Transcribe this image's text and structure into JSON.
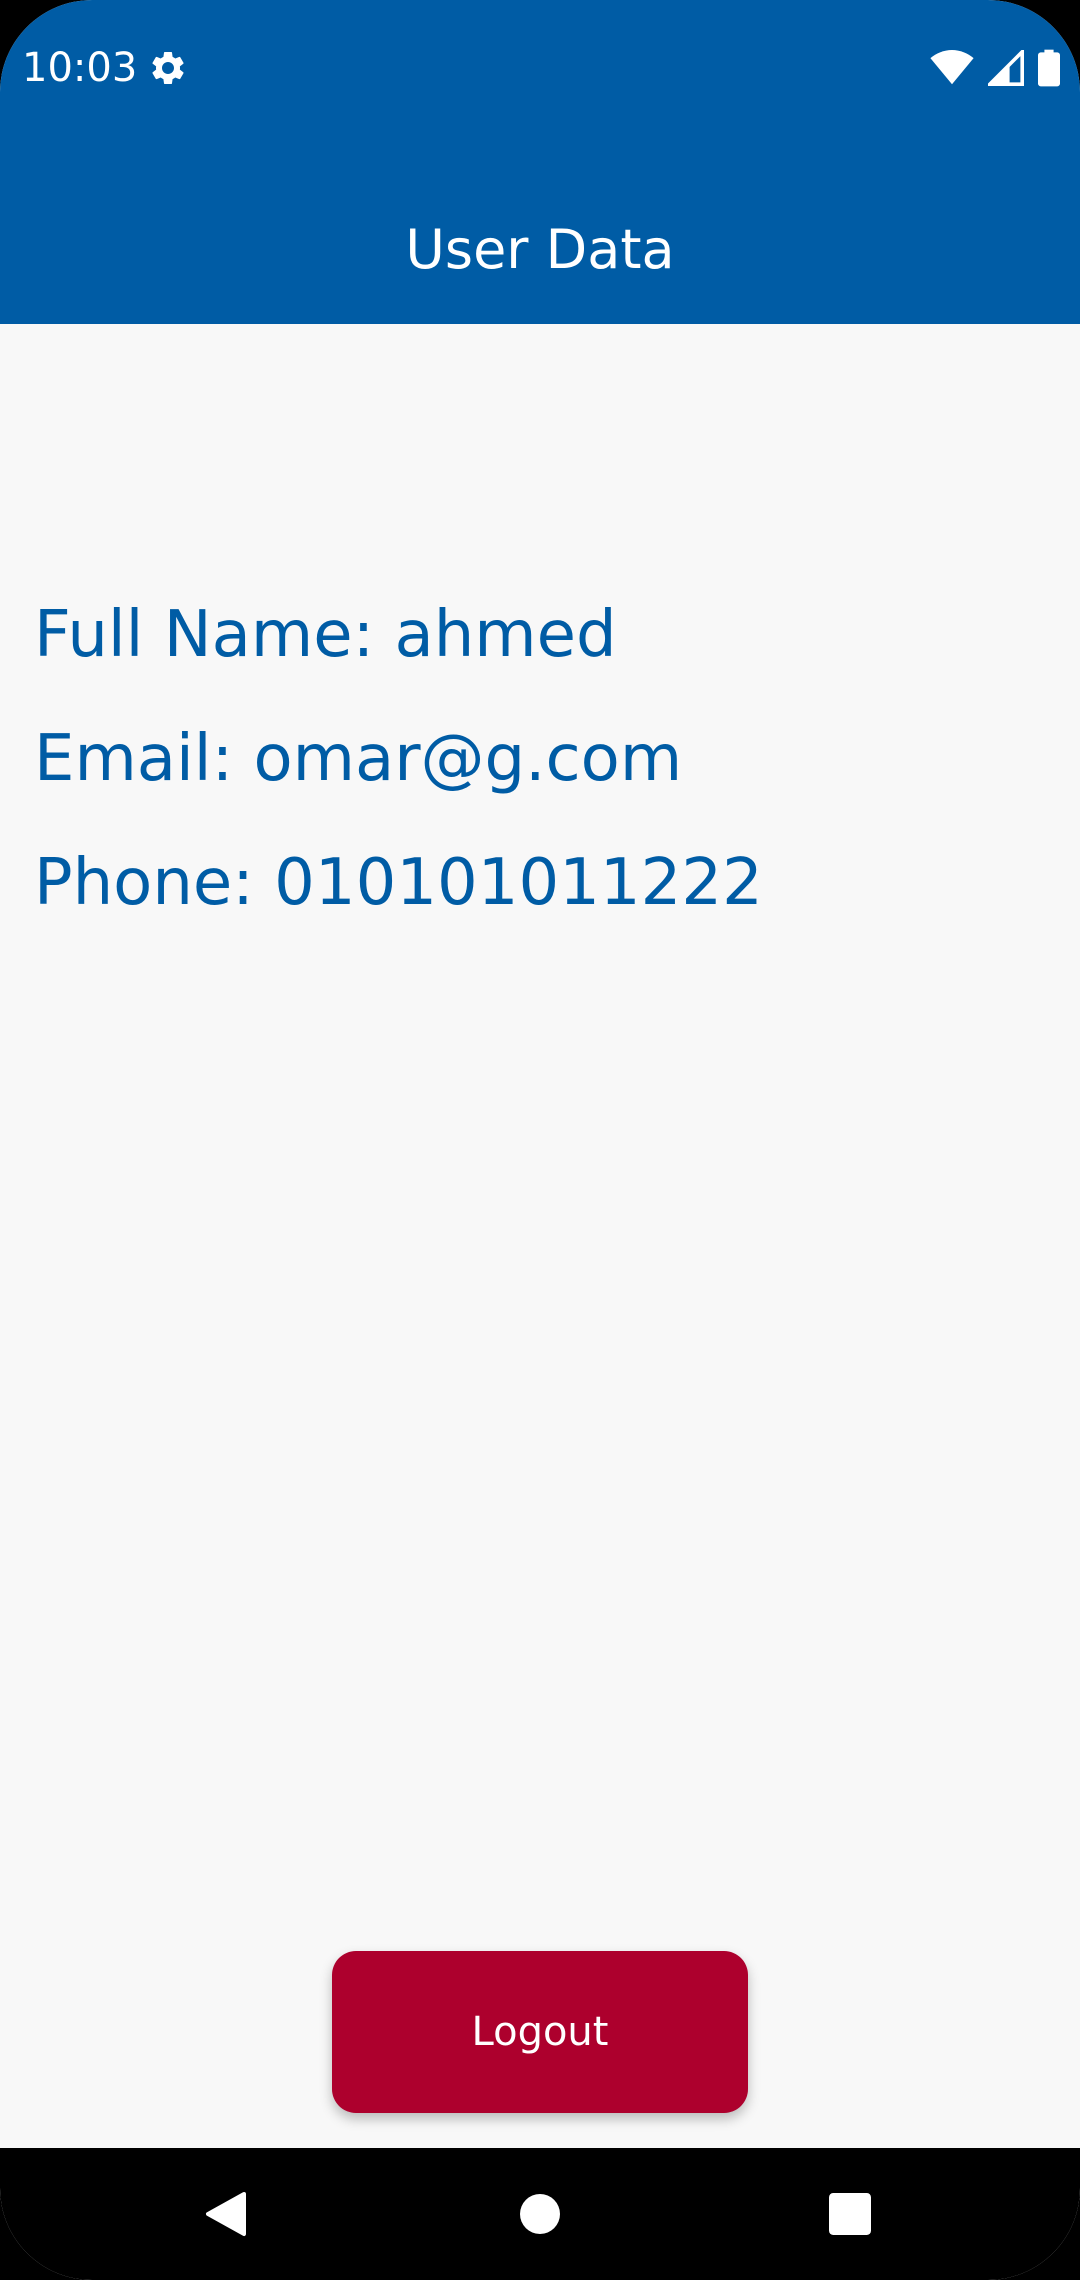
{
  "status_bar": {
    "time": "10:03",
    "icons": [
      "settings-icon",
      "wifi-icon",
      "signal-icon",
      "battery-icon"
    ]
  },
  "app_bar": {
    "title": "User Data"
  },
  "user": {
    "full_name_line": "Full Name: ahmed",
    "email_line": "Email: omar@g.com",
    "phone_line": "Phone: 010101011222"
  },
  "actions": {
    "logout_label": "Logout"
  },
  "nav_bar": {
    "icons": [
      "back-icon",
      "home-icon",
      "recents-icon"
    ]
  },
  "colors": {
    "primary": "#005ca5",
    "logout": "#ad002d",
    "background": "#f8f8f8",
    "nav_background": "#000000"
  }
}
